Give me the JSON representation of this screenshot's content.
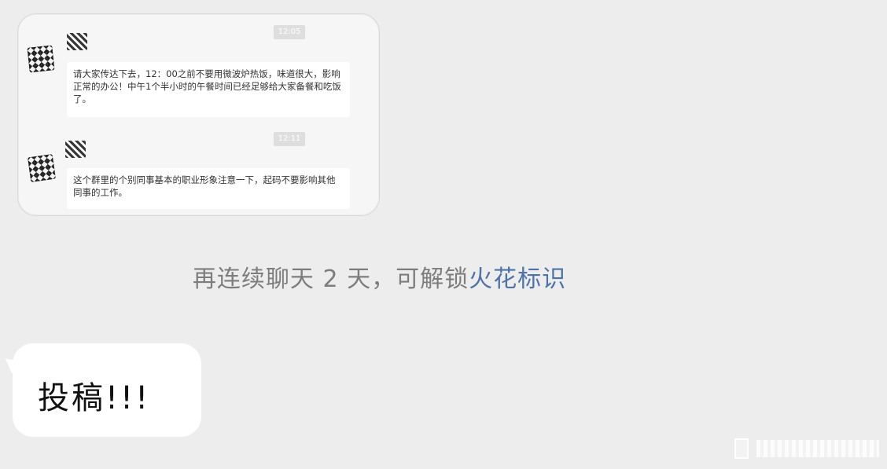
{
  "embedded_screenshot": {
    "messages": [
      {
        "time": "12:05",
        "text": "请大家传达下去，12：00之前不要用微波炉热饭，味道很大，影响正常的办公！中午1个半小时的午餐时间已经足够给大家备餐和吃饭了。"
      },
      {
        "time": "12:11",
        "text": "这个群里的个别同事基本的职业形象注意一下，起码不要影响其他同事的工作。"
      }
    ]
  },
  "system_hint": {
    "prefix": "再连续聊天 2 天，可解锁",
    "link": "火花标识",
    "link_color": "#4f73a7"
  },
  "incoming_message": {
    "text": "投稿!!!"
  },
  "colors": {
    "background": "#ededed",
    "bubble": "#ffffff",
    "hint_text": "#7d7d7d"
  }
}
